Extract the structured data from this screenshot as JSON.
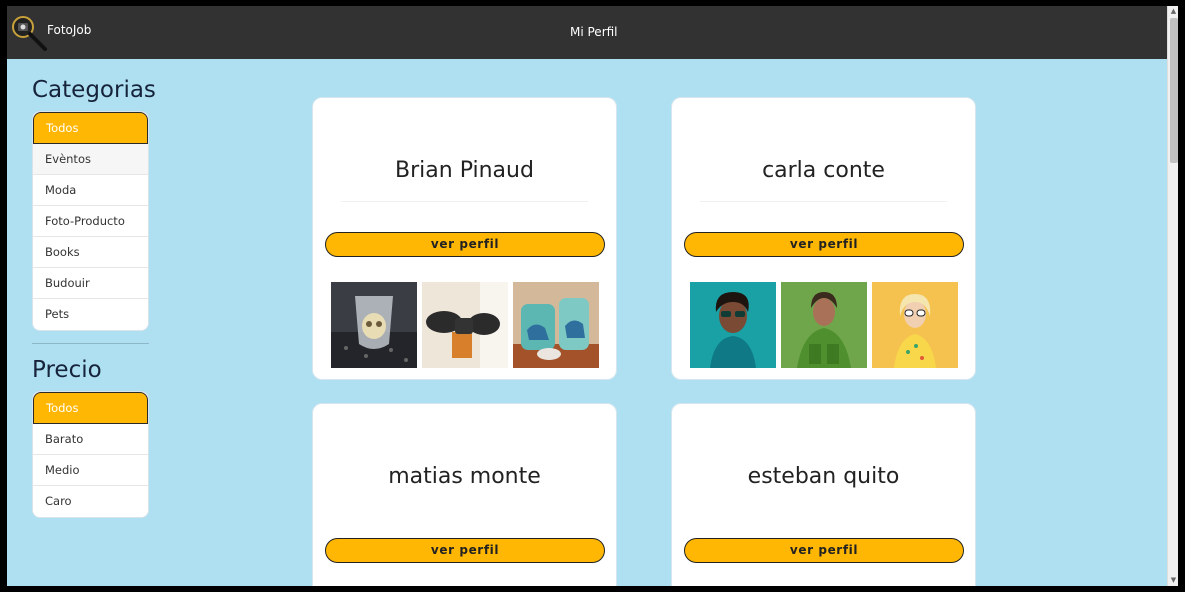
{
  "navbar": {
    "brand": "FotoJob",
    "logo_icon": "magnifier-camera-icon",
    "link": "Mi Perfil"
  },
  "sidebar": {
    "categories_title": "Categorias",
    "categories": [
      {
        "label": "Todos"
      },
      {
        "label": "Evèntos"
      },
      {
        "label": "Moda"
      },
      {
        "label": "Foto-Producto"
      },
      {
        "label": "Books"
      },
      {
        "label": "Budouir"
      },
      {
        "label": "Pets"
      }
    ],
    "price_title": "Precio",
    "prices": [
      {
        "label": "Todos"
      },
      {
        "label": "Barato"
      },
      {
        "label": "Medio"
      },
      {
        "label": "Caro"
      }
    ]
  },
  "cards": [
    {
      "name": "Brian Pinaud",
      "button": "ver perfil"
    },
    {
      "name": "carla conte",
      "button": "ver perfil"
    },
    {
      "name": "matias monte",
      "button": "ver perfil"
    },
    {
      "name": "esteban quito",
      "button": "ver perfil"
    }
  ],
  "colors": {
    "accent": "#ffb703",
    "navbar": "#323232",
    "background": "#aee0f2"
  }
}
